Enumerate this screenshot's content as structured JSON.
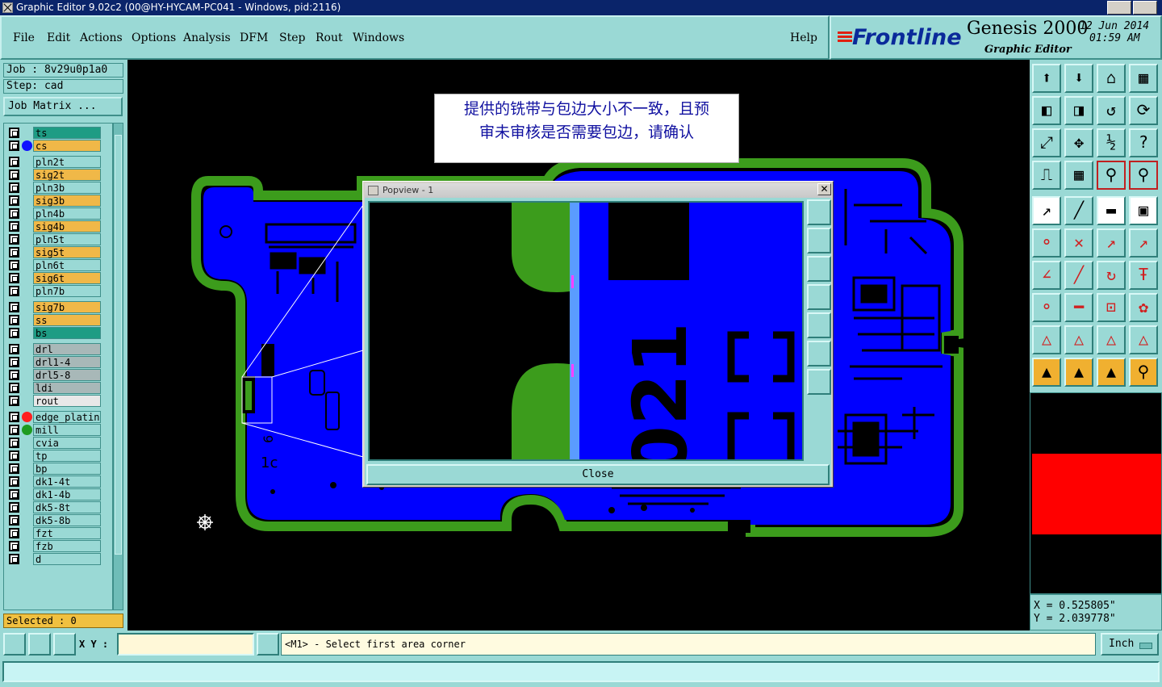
{
  "window": {
    "title": "Graphic Editor 9.02c2 (00@HY-HYCAM-PC041 - Windows, pid:2116)"
  },
  "menu": {
    "file": "File",
    "edit": "Edit",
    "actions": "Actions",
    "options": "Options",
    "analysis": "Analysis",
    "dfm": "DFM",
    "step": "Step",
    "rout": "Rout",
    "windows": "Windows",
    "help": "Help"
  },
  "brand": {
    "logo": "Frontline",
    "product": "Genesis 2000",
    "subtitle": "Graphic Editor",
    "date": "12 Jun 2014",
    "time": "01:59 AM"
  },
  "job": {
    "job_line": "Job : 8v29u0p1a0",
    "step_line": "Step: cad",
    "matrix_button": "Job Matrix ..."
  },
  "layers": [
    {
      "name": "ts",
      "color": "#1e9c84",
      "dot": ""
    },
    {
      "name": "cs",
      "color": "#f0b848",
      "dot": "#1010ff"
    },
    {
      "name": "pln2t",
      "color": "#9ad9d5",
      "dot": ""
    },
    {
      "name": "sig2t",
      "color": "#f0b848",
      "dot": ""
    },
    {
      "name": "pln3b",
      "color": "#9ad9d5",
      "dot": ""
    },
    {
      "name": "sig3b",
      "color": "#f0b848",
      "dot": ""
    },
    {
      "name": "pln4b",
      "color": "#9ad9d5",
      "dot": ""
    },
    {
      "name": "sig4b",
      "color": "#f0b848",
      "dot": ""
    },
    {
      "name": "pln5t",
      "color": "#9ad9d5",
      "dot": ""
    },
    {
      "name": "sig5t",
      "color": "#f0b848",
      "dot": ""
    },
    {
      "name": "pln6t",
      "color": "#9ad9d5",
      "dot": ""
    },
    {
      "name": "sig6t",
      "color": "#f0b848",
      "dot": ""
    },
    {
      "name": "pln7b",
      "color": "#9ad9d5",
      "dot": ""
    },
    {
      "name": "sig7b",
      "color": "#f0b848",
      "dot": ""
    },
    {
      "name": "ss",
      "color": "#f0b848",
      "dot": ""
    },
    {
      "name": "bs",
      "color": "#1e9c84",
      "dot": ""
    },
    {
      "name": "drl",
      "color": "#a8b8b8",
      "dot": ""
    },
    {
      "name": "drl1-4",
      "color": "#a8b8b8",
      "dot": ""
    },
    {
      "name": "drl5-8",
      "color": "#a8b8b8",
      "dot": ""
    },
    {
      "name": "ldi",
      "color": "#a8b8b8",
      "dot": ""
    },
    {
      "name": "rout",
      "color": "#e8e8e8",
      "dot": ""
    },
    {
      "name": "edge_platin",
      "color": "#9ad9d5",
      "dot": "#ff2020"
    },
    {
      "name": "mill",
      "color": "#9ad9d5",
      "dot": "#1e9c20"
    },
    {
      "name": "cvia",
      "color": "#9ad9d5",
      "dot": ""
    },
    {
      "name": "tp",
      "color": "#9ad9d5",
      "dot": ""
    },
    {
      "name": "bp",
      "color": "#9ad9d5",
      "dot": ""
    },
    {
      "name": "dk1-4t",
      "color": "#9ad9d5",
      "dot": ""
    },
    {
      "name": "dk1-4b",
      "color": "#9ad9d5",
      "dot": ""
    },
    {
      "name": "dk5-8t",
      "color": "#9ad9d5",
      "dot": ""
    },
    {
      "name": "dk5-8b",
      "color": "#9ad9d5",
      "dot": ""
    },
    {
      "name": "fzt",
      "color": "#9ad9d5",
      "dot": ""
    },
    {
      "name": "fzb",
      "color": "#9ad9d5",
      "dot": ""
    },
    {
      "name": "d",
      "color": "#9ad9d5",
      "dot": ""
    }
  ],
  "selected": "Selected : 0",
  "note": {
    "line1": "提供的铣带与包边大小不一致，且预",
    "line2": "审未审核是否需要包边，请确认"
  },
  "popview": {
    "title": "Popview - 1",
    "close": "Close",
    "silk_text": "021",
    "tools": [
      "zoom-fit",
      "pan-up",
      "pan-down",
      "pan-left",
      "pan-right",
      "zoom-in",
      "zoom-out"
    ]
  },
  "canvas": {
    "board_label": "1c",
    "edge_label": "6"
  },
  "coords": {
    "x": "X = 0.525805\"",
    "y": "Y = 2.039778\""
  },
  "status": {
    "xy_label": "X Y :",
    "xy_value": "",
    "prompt": "<M1> - Select first area corner",
    "unit": "Inch",
    "message": ""
  },
  "colors": {
    "panel": "#9ad9d5",
    "board": "#0000ff",
    "edge": "#3c9c1c",
    "accent": "#f0b848"
  }
}
